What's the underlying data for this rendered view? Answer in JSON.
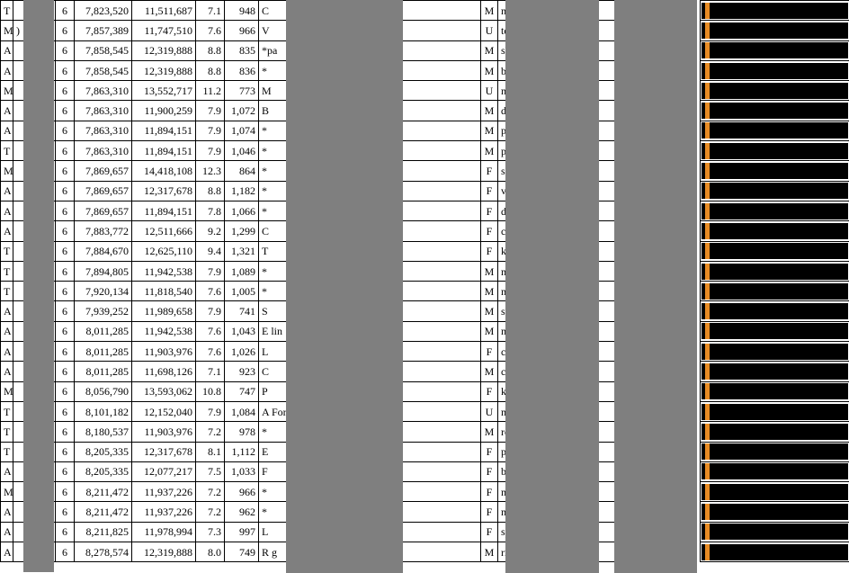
{
  "rows": [
    {
      "c0": "T",
      "c1": "",
      "c2": "6",
      "c3": "7,823,520",
      "c4": "11,511,687",
      "c5": "7.1",
      "c6": "948",
      "c7": "C",
      "c8": "M",
      "c9": "ma",
      "bar": true
    },
    {
      "c0": "M",
      "c1": ")",
      "c2": "6",
      "c3": "7,857,389",
      "c4": "11,747,510",
      "c5": "7.6",
      "c6": "966",
      "c7": "V",
      "c8": "U",
      "c9": "te",
      "bar": true
    },
    {
      "c0": "A",
      "c1": "",
      "c2": "6",
      "c3": "7,858,545",
      "c4": "12,319,888",
      "c5": "8.8",
      "c6": "835",
      "c7": "*pa",
      "c8": "M",
      "c9": "sh         ok.com",
      "bar": true
    },
    {
      "c0": "A",
      "c1": "",
      "c2": "6",
      "c3": "7,858,545",
      "c4": "12,319,888",
      "c5": "8.8",
      "c6": "836",
      "c7": "*",
      "c8": "M",
      "c9": "br         net",
      "bar": true
    },
    {
      "c0": "M",
      "c1": "",
      "c2": "6",
      "c3": "7,863,310",
      "c4": "13,552,717",
      "c5": "11.2",
      "c6": "773",
      "c7": "M",
      "c8": "U",
      "c9": "mi",
      "bar": true
    },
    {
      "c0": "A",
      "c1": "",
      "c2": "6",
      "c3": "7,863,310",
      "c4": "11,900,259",
      "c5": "7.9",
      "c6": "1,072",
      "c7": "B",
      "c8": "M",
      "c9": "dt         .com",
      "bar": true
    },
    {
      "c0": "A",
      "c1": "",
      "c2": "6",
      "c3": "7,863,310",
      "c4": "11,894,151",
      "c5": "7.9",
      "c6": "1,074",
      "c7": "*",
      "c8": "M",
      "c9": "pz",
      "bar": true
    },
    {
      "c0": "T",
      "c1": "",
      "c2": "6",
      "c3": "7,863,310",
      "c4": "11,894,151",
      "c5": "7.9",
      "c6": "1,046",
      "c7": "*",
      "c8": "M",
      "c9": "pz",
      "bar": true
    },
    {
      "c0": "M",
      "c1": "",
      "c2": "6",
      "c3": "7,869,657",
      "c4": "14,418,108",
      "c5": "12.3",
      "c6": "864",
      "c7": "*",
      "c8": "F",
      "c9": "sg",
      "bar": true
    },
    {
      "c0": "A",
      "c1": "",
      "c2": "6",
      "c3": "7,869,657",
      "c4": "12,317,678",
      "c5": "8.8",
      "c6": "1,182",
      "c7": "*",
      "c8": "F",
      "c9": "ve",
      "bar": true
    },
    {
      "c0": "A",
      "c1": "",
      "c2": "6",
      "c3": "7,869,657",
      "c4": "11,894,151",
      "c5": "7.8",
      "c6": "1,066",
      "c7": "*",
      "c8": "F",
      "c9": "da         net",
      "bar": true
    },
    {
      "c0": "A",
      "c1": "",
      "c2": "6",
      "c3": "7,883,772",
      "c4": "12,511,666",
      "c5": "9.2",
      "c6": "1,299",
      "c7": "C",
      "c8": "F",
      "c9": "cn         n",
      "bar": true
    },
    {
      "c0": "T",
      "c1": "",
      "c2": "6",
      "c3": "7,884,670",
      "c4": "12,625,110",
      "c5": "9.4",
      "c6": "1,321",
      "c7": "T",
      "c8": "F",
      "c9": "ke",
      "bar": true
    },
    {
      "c0": "T",
      "c1": "",
      "c2": "6",
      "c3": "7,894,805",
      "c4": "11,942,538",
      "c5": "7.9",
      "c6": "1,089",
      "c7": "*",
      "c8": "M",
      "c9": "me",
      "bar": true
    },
    {
      "c0": "T",
      "c1": "",
      "c2": "6",
      "c3": "7,920,134",
      "c4": "11,818,540",
      "c5": "7.6",
      "c6": "1,005",
      "c7": "*",
      "c8": "M",
      "c9": "mo         n",
      "bar": true
    },
    {
      "c0": "A",
      "c1": "",
      "c2": "6",
      "c3": "7,939,252",
      "c4": "11,989,658",
      "c5": "7.9",
      "c6": "741",
      "c7": "S",
      "c8": "M",
      "c9": "ste",
      "bar": true
    },
    {
      "c0": "A",
      "c1": "",
      "c2": "6",
      "c3": "8,011,285",
      "c4": "11,942,538",
      "c5": "7.6",
      "c6": "1,043",
      "c7": "E  lin",
      "c8": "M",
      "c9": "mi         o.com",
      "bar": true
    },
    {
      "c0": "A",
      "c1": "",
      "c2": "6",
      "c3": "8,011,285",
      "c4": "11,903,976",
      "c5": "7.6",
      "c6": "1,026",
      "c7": "L",
      "c8": "F",
      "c9": "ch",
      "bar": true
    },
    {
      "c0": "A",
      "c1": "",
      "c2": "6",
      "c3": "8,011,285",
      "c4": "11,698,126",
      "c5": "7.1",
      "c6": "923",
      "c7": "C",
      "c8": "M",
      "c9": "ch         com",
      "bar": true
    },
    {
      "c0": "M",
      "c1": "",
      "c2": "6",
      "c3": "8,056,790",
      "c4": "13,593,062",
      "c5": "10.8",
      "c6": "747",
      "c7": "P",
      "c8": "F",
      "c9": "ki         net",
      "bar": true
    },
    {
      "c0": "T",
      "c1": "",
      "c2": "6",
      "c3": "8,101,182",
      "c4": "12,152,040",
      "c5": "7.9",
      "c6": "1,084",
      "c7": "A  Ford",
      "c8": "U",
      "c9": "mf",
      "bar": true
    },
    {
      "c0": "T",
      "c1": "",
      "c2": "6",
      "c3": "8,180,537",
      "c4": "11,903,976",
      "c5": "7.2",
      "c6": "978",
      "c7": "*",
      "c8": "M",
      "c9": "ro",
      "bar": true
    },
    {
      "c0": "T",
      "c1": "",
      "c2": "6",
      "c3": "8,205,335",
      "c4": "12,317,678",
      "c5": "8.1",
      "c6": "1,112",
      "c7": "E",
      "c8": "F",
      "c9": "pe         gmail.com",
      "bar": true
    },
    {
      "c0": "A",
      "c1": "",
      "c2": "6",
      "c3": "8,205,335",
      "c4": "12,077,217",
      "c5": "7.5",
      "c6": "1,033",
      "c7": "F",
      "c8": "F",
      "c9": "bu         com",
      "bar": true
    },
    {
      "c0": "M",
      "c1": "",
      "c2": "6",
      "c3": "8,211,472",
      "c4": "11,937,226",
      "c5": "7.2",
      "c6": "966",
      "c7": "*",
      "c8": "F",
      "c9": "mo         n",
      "bar": true
    },
    {
      "c0": "A",
      "c1": "",
      "c2": "6",
      "c3": "8,211,472",
      "c4": "11,937,226",
      "c5": "7.2",
      "c6": "962",
      "c7": "*",
      "c8": "F",
      "c9": "me         n",
      "bar": true
    },
    {
      "c0": "A",
      "c1": "",
      "c2": "6",
      "c3": "8,211,825",
      "c4": "11,978,994",
      "c5": "7.3",
      "c6": "997",
      "c7": "L",
      "c8": "F",
      "c9": "sp         com",
      "bar": true
    },
    {
      "c0": "A",
      "c1": "",
      "c2": "6",
      "c3": "8,278,574",
      "c4": "12,319,888",
      "c5": "8.0",
      "c6": "749",
      "c7": "R  g",
      "c8": "M",
      "c9": "rm         n",
      "bar": true
    }
  ]
}
